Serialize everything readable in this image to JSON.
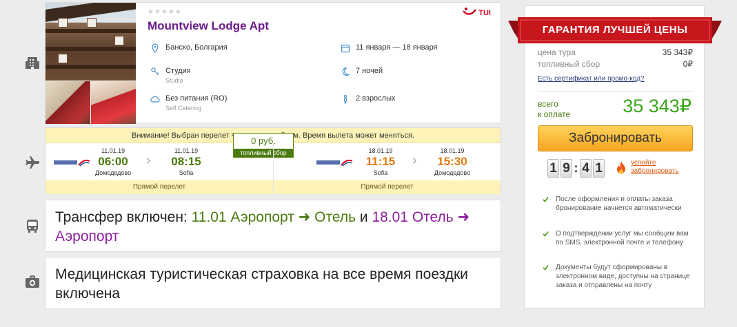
{
  "hotel": {
    "stars": "★★★★★",
    "name": "Mountview Lodge Apt",
    "operator": "TUI",
    "location": "Банско, Болгария",
    "dates": "11 января — 18 января",
    "room": "Студия",
    "room_sub": "Studio",
    "nights": "7 ночей",
    "meal": "Без питания (RO)",
    "meal_sub": "Self Catering",
    "guests": "2 взрослых"
  },
  "flight": {
    "warning": "Внимание! Выбран перелет чартерным рейсом. Время вылета может меняться.",
    "outbound": {
      "dep_date": "11.01.19",
      "dep_time": "06:00",
      "dep_airport": "Домодедово",
      "arr_date": "11.01.19",
      "arr_time": "08:15",
      "arr_airport": "Sofia",
      "type": "Прямой перелет"
    },
    "return": {
      "dep_date": "18.01.19",
      "dep_time": "11:15",
      "dep_airport": "Sofia",
      "arr_date": "18.01.19",
      "arr_time": "15:30",
      "arr_airport": "Домодедово",
      "type": "Прямой перелет"
    },
    "fuel_value": "0 руб.",
    "fuel_label": "топливный сбор",
    "airline_logo": "Ural Airlines"
  },
  "transfer": {
    "prefix": "Трансфер включен:",
    "out": "11.01 Аэропорт ➜ Отель",
    "and": "и",
    "back": "18.01 Отель ➜ Аэропорт"
  },
  "insurance": {
    "text": "Медицинская туристическая страховка на все время поездки включена"
  },
  "price": {
    "ribbon": "ГАРАНТИЯ ЛУЧШЕЙ ЦЕНЫ",
    "tour_label": "цена тура",
    "tour_value": "35 343₽",
    "fuel_label": "топливный сбор",
    "fuel_value": "0₽",
    "promo": "Есть сертификат или промо-код?",
    "total_label_1": "всего",
    "total_label_2": "к оплате",
    "total_value": "35 343₽",
    "book": "Забронировать",
    "timer": [
      "1",
      "9",
      "4",
      "1"
    ],
    "hurry_1": "успейте",
    "hurry_2": "забронировать",
    "notes": [
      "После оформления и оплаты заказа бронирование начнется автоматически",
      "О подтверждении услуг мы сообщим вам по SMS, электронной почте и телефону",
      "Документы будут сформированы в электронном виде, доступны на странице заказа и отправлены на почту"
    ]
  },
  "colors": {
    "accent_purple": "#6b1a8a",
    "green": "#4a7a0e",
    "orange": "#e07a10",
    "ribbon_red": "#c8161d",
    "book_button": "#f6a520"
  }
}
